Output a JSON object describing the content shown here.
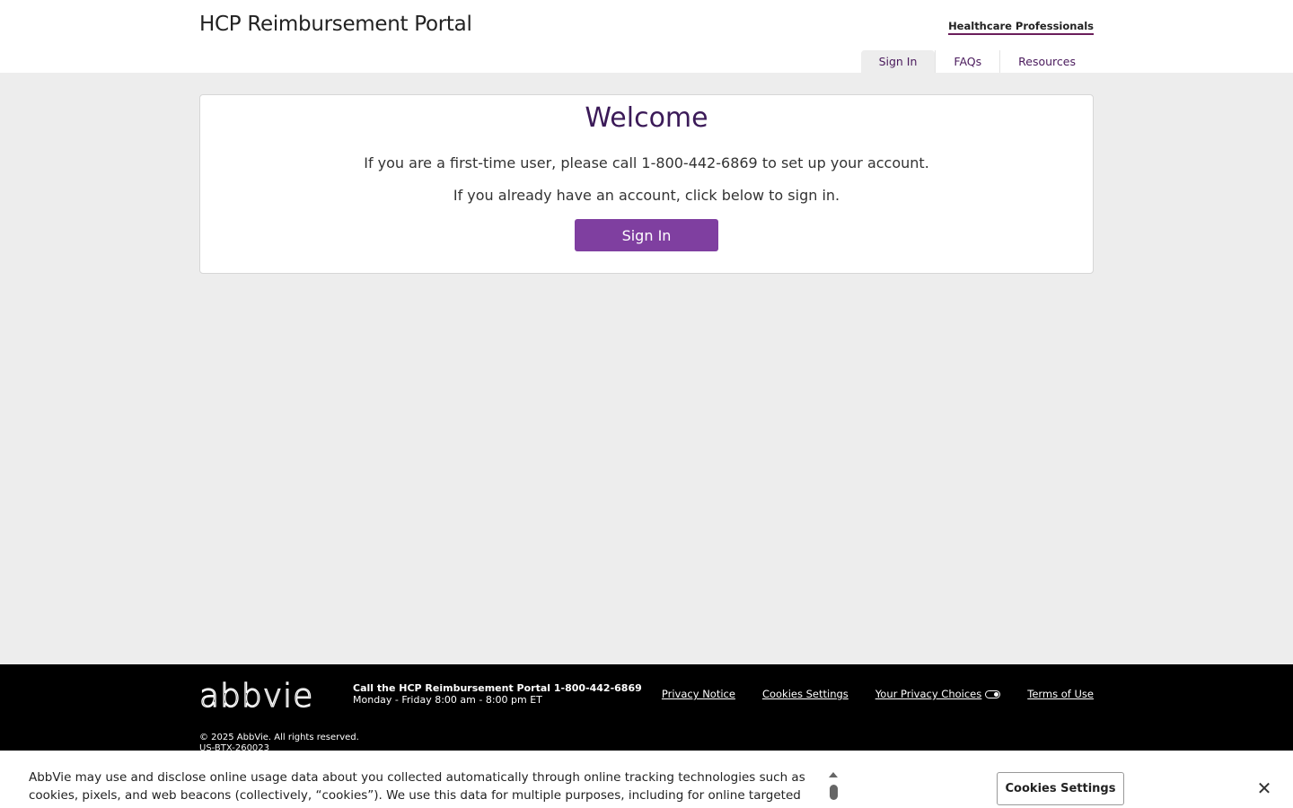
{
  "header": {
    "title": "HCP Reimbursement Portal",
    "audience_link": "Healthcare Professionals",
    "tabs": [
      {
        "label": "Sign In",
        "active": true
      },
      {
        "label": "FAQs",
        "active": false
      },
      {
        "label": "Resources",
        "active": false
      }
    ]
  },
  "welcome": {
    "title": "Welcome",
    "line1": "If you are a first-time user, please call 1-800-442-6869 to set up your account.",
    "line2": "If you already have an account, click below to sign in.",
    "signin_label": "Sign In"
  },
  "footer": {
    "logo": "abbvie",
    "call_heading": "Call the HCP Reimbursement Portal 1-800-442-6869",
    "call_hours": "Monday - Friday 8:00 am - 8:00 pm ET",
    "links": [
      "Privacy Notice",
      "Cookies Settings",
      "Your Privacy Choices",
      "Terms of Use"
    ],
    "copyright": "© 2025 AbbVie. All rights reserved.",
    "code": "US-BTX-260023"
  },
  "cookie_banner": {
    "text": "AbbVie may use and disclose online usage data about you collected automatically through online tracking technologies such as cookies, pixels, and web beacons (collectively, “cookies”). We use this data for multiple purposes, including for online targeted advertising (advertisements based",
    "settings_label": "Cookies Settings",
    "close_glyph": "✕"
  },
  "colors": {
    "primary_button": "#7f3fa0",
    "title_purple": "#3b1a58",
    "footer_bg": "#000000",
    "page_bg": "#ededed"
  }
}
